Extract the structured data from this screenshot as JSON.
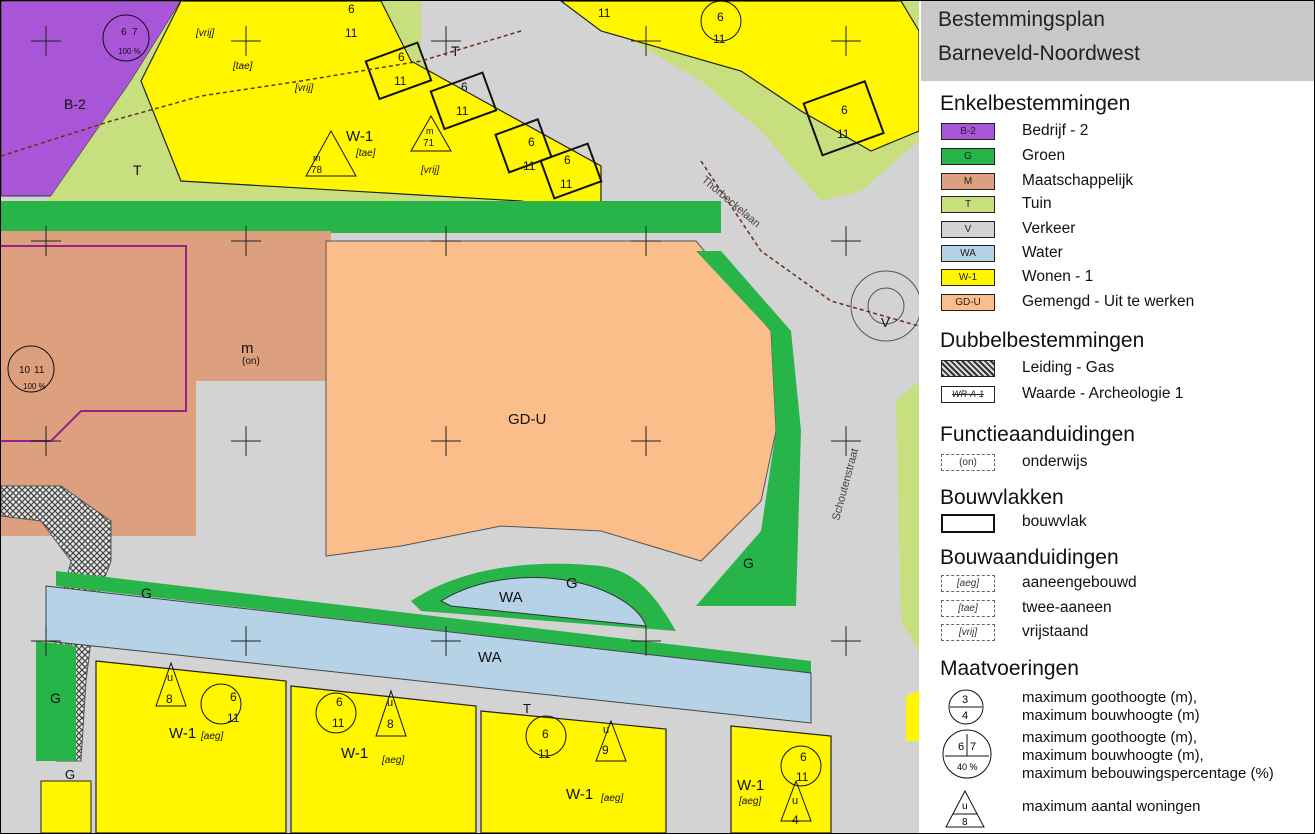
{
  "title": {
    "line1": "Bestemmingsplan",
    "line2": "Barneveld-Noordwest"
  },
  "colors": {
    "bedrijf": "#a855d8",
    "groen": "#27b54a",
    "maatschappelijk": "#dca07e",
    "tuin": "#c8df80",
    "verkeer": "#d3d3d3",
    "water": "#b5d2e6",
    "wonen": "#fff600",
    "gemengd": "#fbbd8a"
  },
  "sections": {
    "enkel": "Enkelbestemmingen",
    "dubbel": "Dubbelbestemmingen",
    "functie": "Functieaanduidingen",
    "bouwvlak": "Bouwvlakken",
    "bouwaan": "Bouwaanduidingen",
    "maat": "Maatvoeringen"
  },
  "enkel": [
    {
      "code": "B-2",
      "label": "Bedrijf - 2"
    },
    {
      "code": "G",
      "label": "Groen"
    },
    {
      "code": "M",
      "label": "Maatschappelijk"
    },
    {
      "code": "T",
      "label": "Tuin"
    },
    {
      "code": "V",
      "label": "Verkeer"
    },
    {
      "code": "WA",
      "label": "Water"
    },
    {
      "code": "W-1",
      "label": "Wonen - 1"
    },
    {
      "code": "GD-U",
      "label": "Gemengd - Uit te werken"
    }
  ],
  "dubbel": [
    {
      "code": "",
      "label": "Leiding - Gas"
    },
    {
      "code": "WR-A-1",
      "label": "Waarde - Archeologie 1"
    }
  ],
  "functie": [
    {
      "code": "(on)",
      "label": "onderwijs"
    }
  ],
  "bouwvlak": [
    {
      "label": "bouwvlak"
    }
  ],
  "bouwaan": [
    {
      "code": "[aeg]",
      "label": "aaneengebouwd"
    },
    {
      "code": "[tae]",
      "label": "twee-aaneen"
    },
    {
      "code": "[vrij]",
      "label": "vrijstaand"
    }
  ],
  "maat": {
    "sym1": {
      "top": "3",
      "bottom": "4"
    },
    "sym1_text": [
      "maximum goothoogte (m),",
      "maximum bouwhoogte (m)"
    ],
    "sym2": {
      "left": "6",
      "right": "7",
      "pct": "40 %"
    },
    "sym2_text": [
      "maximum goothoogte (m),",
      "maximum bouwhoogte (m),",
      "maximum bebouwingspercentage (%)"
    ],
    "sym3": {
      "top": "u",
      "bottom": "8"
    },
    "sym3_text": [
      "maximum aantal woningen"
    ]
  },
  "map_labels": {
    "b2": "B-2",
    "t1": "T",
    "t2": "T",
    "t3": "T",
    "w1a": "W-1",
    "w1b": "W-1",
    "w1c": "W-1",
    "w1d": "W-1",
    "w1e": "W-1",
    "m": "m",
    "on": "(on)",
    "gdu": "GD-U",
    "g1": "G",
    "g2": "G",
    "g3": "G",
    "g4": "G",
    "g5": "G",
    "wa1": "WA",
    "wa2": "WA",
    "v": "V",
    "tae1": "[tae]",
    "tae2": "[tae]",
    "vrij1": "[vrij]",
    "vrij2": "[vrij]",
    "vrij3": "[vrij]",
    "aeg1": "[aeg]",
    "aeg2": "[aeg]",
    "aeg3": "[aeg]",
    "aeg4": "[aeg]",
    "street1": "Thorbeckelaan",
    "street2": "Schoutenstraat",
    "pct100a": "100 %",
    "pct100b": "100 %",
    "num6": "6",
    "num7": "7",
    "num11": "11",
    "num10": "10",
    "num9": "9",
    "num8": "8",
    "num4": "4",
    "num71": "71",
    "num78": "78",
    "u": "u"
  }
}
